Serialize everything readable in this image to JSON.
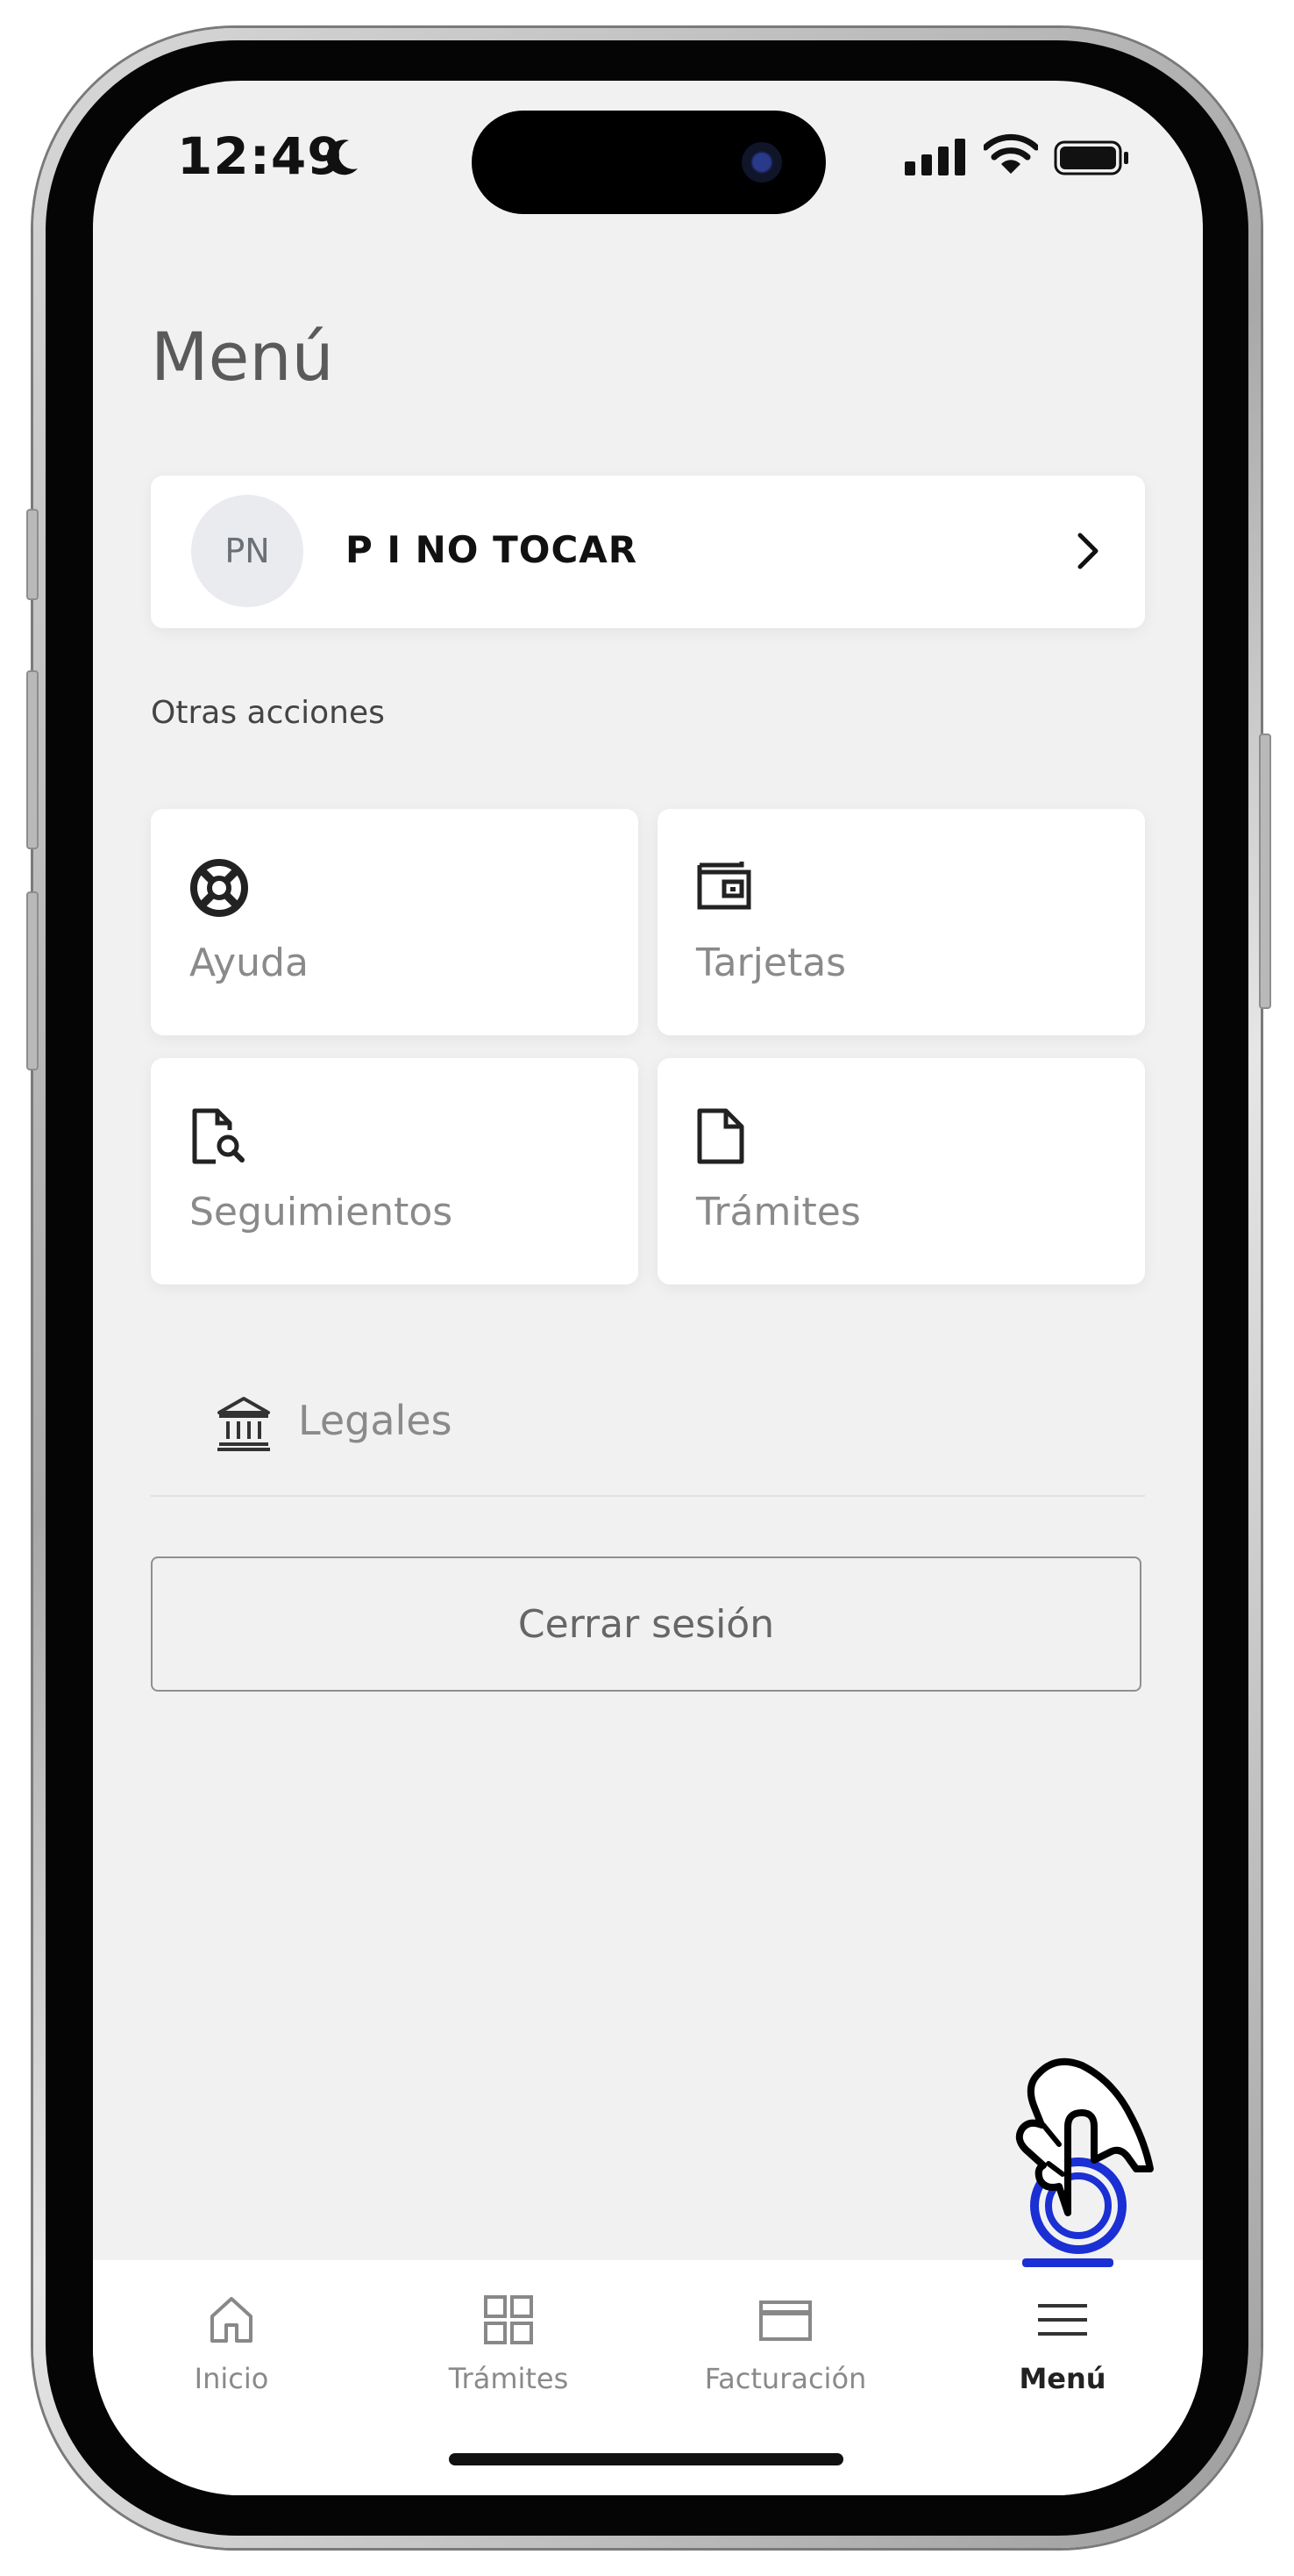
{
  "status_bar": {
    "time": "12:49"
  },
  "header": {
    "title": "Menú"
  },
  "profile": {
    "initials": "PN",
    "name": "P I NO TOCAR"
  },
  "section": {
    "label": "Otras acciones"
  },
  "tiles": [
    {
      "label": "Ayuda",
      "icon": "lifebuoy-icon"
    },
    {
      "label": "Tarjetas",
      "icon": "wallet-icon"
    },
    {
      "label": "Seguimientos",
      "icon": "document-search-icon"
    },
    {
      "label": "Trámites",
      "icon": "document-icon"
    }
  ],
  "legales": {
    "label": "Legales",
    "icon": "bank-icon"
  },
  "logout": {
    "label": "Cerrar sesión"
  },
  "tabbar": {
    "items": [
      {
        "label": "Inicio",
        "icon": "home-icon",
        "active": false
      },
      {
        "label": "Trámites",
        "icon": "grid-icon",
        "active": false
      },
      {
        "label": "Facturación",
        "icon": "card-icon",
        "active": false
      },
      {
        "label": "Menú",
        "icon": "hamburger-icon",
        "active": true
      }
    ]
  },
  "colors": {
    "accent": "#1a2fd4",
    "background": "#f1f1f1",
    "card": "#ffffff"
  }
}
